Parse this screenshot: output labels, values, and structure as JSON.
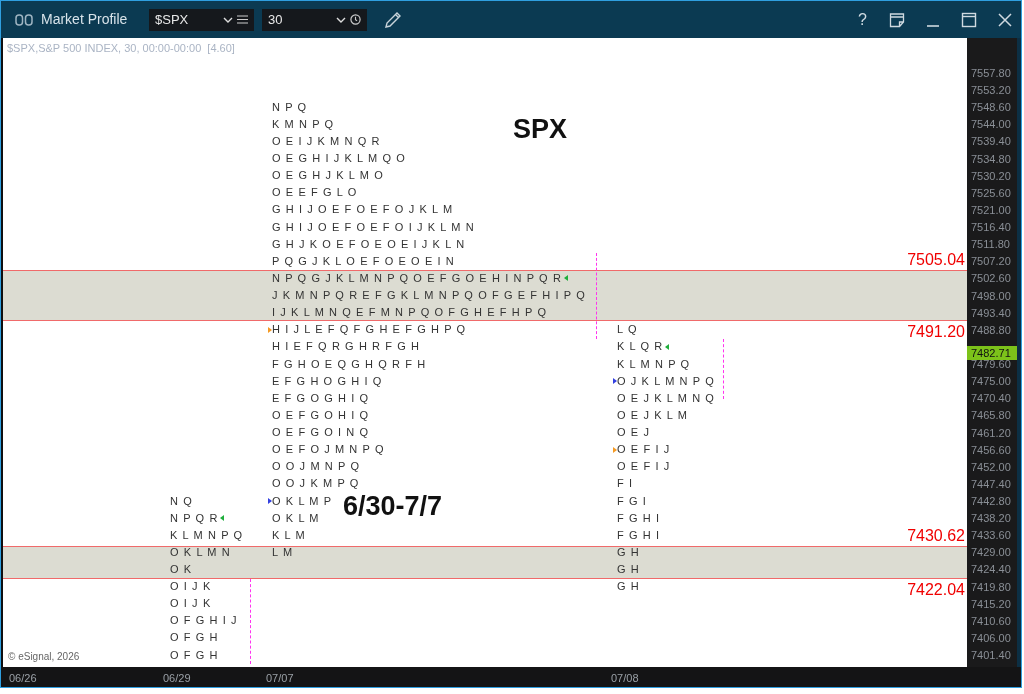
{
  "window": {
    "title": "Market Profile",
    "help": "?"
  },
  "toolbar": {
    "symbol": "$SPX",
    "interval": "30"
  },
  "chart": {
    "info": "$SPX,S&P 500 INDEX, 30, 00:00-00:00  [4.60]",
    "annotations": [
      {
        "text": "SPX"
      },
      {
        "text": "6/30-7/7"
      }
    ],
    "profiles": [
      {
        "rows": [
          {
            "letters": "N Q"
          },
          {
            "letters": "N P Q R",
            "kind": "close"
          },
          {
            "letters": "K L M N P Q"
          },
          {
            "letters": "O K L M N"
          },
          {
            "letters": "O K"
          },
          {
            "letters": "O I J K"
          },
          {
            "letters": "O I J K"
          },
          {
            "letters": "O F G H I J"
          },
          {
            "letters": "O F G H"
          },
          {
            "letters": "O F G H"
          }
        ]
      },
      {
        "rows": [
          {
            "letters": "N P Q"
          },
          {
            "letters": "K M N P Q"
          },
          {
            "letters": "O E I J K M N Q R"
          },
          {
            "letters": "O E G H I J K L M Q O"
          },
          {
            "letters": "O E G H J K L M O"
          },
          {
            "letters": "O E E F G L O"
          },
          {
            "letters": "G H I J O E F O E F O J K L M"
          },
          {
            "letters": "G H I J O E F O E F O I J K L M N"
          },
          {
            "letters": "G H J K O E F O E O E I J K L N"
          },
          {
            "letters": "P Q G J K L O E F O E O E I N"
          },
          {
            "letters": "N P Q G J K L M N P Q O E F G O E H I N P Q R",
            "kind": "close"
          },
          {
            "letters": "J K M N P Q R E F G K L M N P Q O F G E F H I P Q"
          },
          {
            "letters": "I J K L M N Q E F M N P Q O F G H E F H P Q"
          },
          {
            "letters": "H I J L E F Q F G H E F G H P Q",
            "kind": "open"
          },
          {
            "letters": "H I E F Q R G H R F G H"
          },
          {
            "letters": "F G H O E Q G H Q R F H"
          },
          {
            "letters": "E F G H O G H I Q"
          },
          {
            "letters": "E F G O G H I Q"
          },
          {
            "letters": "O E F G O H I Q"
          },
          {
            "letters": "O E F G O I N Q"
          },
          {
            "letters": "O E F O J M N P Q"
          },
          {
            "letters": "O O J M N P Q"
          },
          {
            "letters": "O O J K M P Q"
          },
          {
            "letters": "O K L M P",
            "kind": "initial"
          },
          {
            "letters": "O K L M"
          },
          {
            "letters": "K L M"
          },
          {
            "letters": "L M"
          }
        ]
      },
      {
        "rows": [
          {
            "letters": "L Q"
          },
          {
            "letters": "K L Q R",
            "kind": "close"
          },
          {
            "letters": "K L M N P Q"
          },
          {
            "letters": "O J K L M N P Q",
            "kind": "initial"
          },
          {
            "letters": "O E J K L M N Q"
          },
          {
            "letters": "O E J K L M"
          },
          {
            "letters": "O E J"
          },
          {
            "letters": "O E F I J",
            "kind": "open"
          },
          {
            "letters": "O E F I J"
          },
          {
            "letters": "F I"
          },
          {
            "letters": "F G I"
          },
          {
            "letters": "F G H I"
          },
          {
            "letters": "F G H I"
          },
          {
            "letters": "G H"
          },
          {
            "letters": "G H"
          },
          {
            "letters": "G H"
          }
        ]
      }
    ],
    "value_areas": [
      {
        "high": "7505.04",
        "low": "7491.20"
      },
      {
        "high": "7430.62",
        "low": "7422.04"
      }
    ],
    "price_axis": [
      "7557.80",
      "7553.20",
      "7548.60",
      "7544.00",
      "7539.40",
      "7534.80",
      "7530.20",
      "7525.60",
      "7521.00",
      "7516.40",
      "7511.80",
      "7507.20",
      "7502.60",
      "7498.00",
      "7493.40",
      "7488.80",
      "7479.60",
      "7475.00",
      "7470.40",
      "7465.80",
      "7461.20",
      "7456.60",
      "7452.00",
      "7447.40",
      "7442.80",
      "7438.20",
      "7433.60",
      "7429.00",
      "7424.40",
      "7419.80",
      "7415.20",
      "7410.60",
      "7406.00",
      "7401.40"
    ],
    "last_price": "7482.71",
    "date_axis": [
      "06/26",
      "06/29",
      "07/07",
      "07/08"
    ],
    "copyright": "© eSignal, 2026"
  }
}
